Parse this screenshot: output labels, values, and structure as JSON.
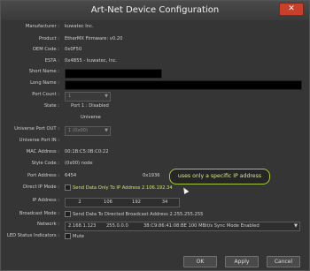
{
  "window": {
    "title": "Art-Net Device Configuration",
    "close_symbol": "✕"
  },
  "fields": {
    "manufacturer": {
      "label": "Manufacturer :",
      "value": "kuwatec Inc."
    },
    "product": {
      "label": "Product :",
      "value": "EtherMX   Firmware: v0.20"
    },
    "oem_code": {
      "label": "OEM Code :",
      "value": "0x0F50"
    },
    "esta": {
      "label": "ESTA :",
      "value": "0x4B55 - kuwatec, Inc."
    },
    "short_name": {
      "label": "Short Name :"
    },
    "long_name": {
      "label": "Long Name :"
    },
    "port_count": {
      "label": "Port Count :",
      "value": "1"
    },
    "state": {
      "label": "State :",
      "value": "Port 1 : Disabled"
    },
    "universe_heading": "Universe",
    "universe_port_out": {
      "label": "Universe Port OUT :",
      "value": "1     (0x00)"
    },
    "universe_port_in": {
      "label": "Universe Port IN :"
    },
    "mac_address": {
      "label": "MAC Address :",
      "value": "00:1B:C5:0B:C0:22"
    },
    "style_code": {
      "label": "Style Code :",
      "value": "(0x00) node"
    },
    "port_address": {
      "label": "Port Address :",
      "value": "6454",
      "value2": "0x1936"
    },
    "direct_ip_mode": {
      "label": "Direct IP Mode :",
      "value": "Send Data Only To IP Address 2.106.192.34"
    },
    "ip_address": {
      "label": "IP Address :",
      "segments": [
        "2",
        "106",
        "192",
        "34"
      ]
    },
    "broadcast_mode": {
      "label": "Broadcast Mode :",
      "value": "Send Data To Directed Broadcast Address 2.255.255.255"
    },
    "network": {
      "label": "Network :",
      "ip": "2.168.1.123",
      "mask": "255.0.0.0",
      "adapter": "38:C9:86:41:08:BE  100 MBit/s  Sync Mode Enabled"
    },
    "led_status": {
      "label": "LED Status Indicators :",
      "value": "Mute"
    }
  },
  "tooltip": "uses only a specific IP address",
  "buttons": {
    "ok": "OK",
    "apply": "Apply",
    "cancel": "Cancel"
  }
}
